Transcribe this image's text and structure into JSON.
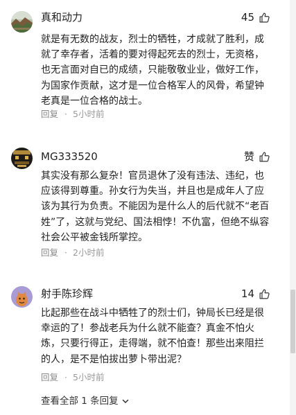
{
  "comments": [
    {
      "username": "真和动力",
      "like_count": "45",
      "text": "就是有无数的战友，烈士的牺牲，才成就了胜利，成就了幸存者，活着的要对得起死去的烈士，无资格，也无言面对自已的成绩，只能敬敬业业，做好工作，为国家作贡献，这才是一位合格军人的风骨，希望钟老真是一位合格的战士。",
      "reply_label": "回复",
      "time": "5小时前",
      "avatar_icon": "avatar-landscape-icon"
    },
    {
      "username": "MG333520",
      "like_count": "赞",
      "text": "其实没有那么复杂！官员退休了没有违法、违纪，也应该得到尊重。孙女行为失当，并且也是成年人了应该为其行为负责。不能因为是什么人的后代就不“老百姓”了，这就与党纪、国法相悖！不仇富，但绝不纵容社会公平被金钱所掌控。",
      "reply_label": "回复",
      "time": "2小时前",
      "avatar_icon": "avatar-dark-pattern-icon"
    },
    {
      "username": "射手陈珍辉",
      "like_count": "14",
      "text": "比起那些在战斗中牺牲了的烈士们，钟局长已经是很幸运的了！参战老兵为什么就不能查？真金不怕火炼，只要行得正，走得端，就不怕查！那些出来阻拦的人，是不是怕拔出萝卜带出泥？",
      "reply_label": "回复",
      "time": "5小时前",
      "avatar_icon": "avatar-cartoon-icon"
    }
  ],
  "view_all": {
    "label": "查看全部 1 条回复",
    "icon": "chevron-down-icon"
  },
  "colors": {
    "text": "#222222",
    "meta": "#888888",
    "background": "#ffffff"
  }
}
